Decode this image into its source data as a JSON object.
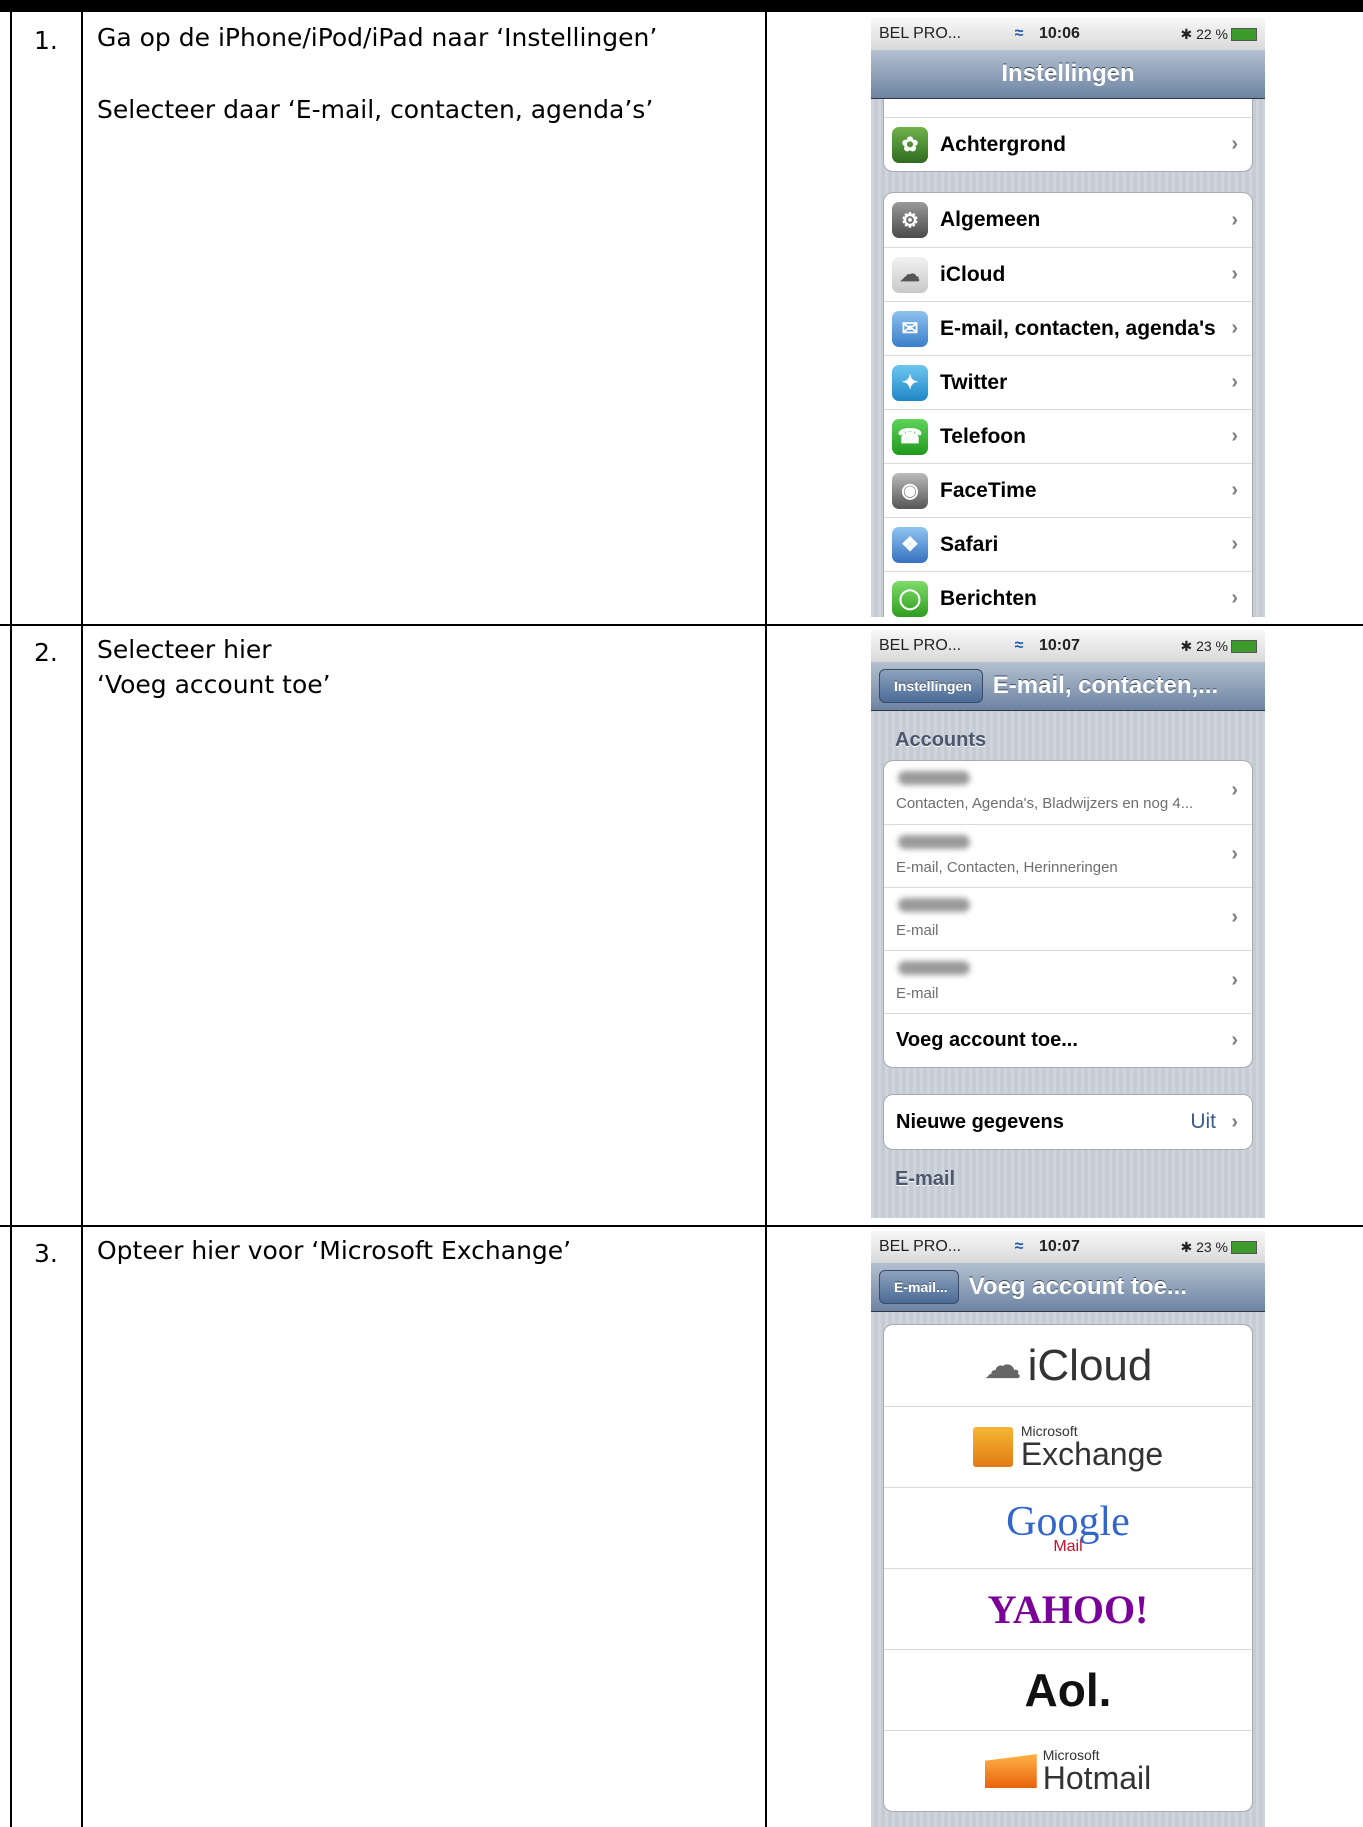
{
  "steps": [
    {
      "number": "1.",
      "lines": [
        "Ga op de iPhone/iPod/iPad naar ‘Instellingen’",
        "Selecteer daar ‘E-mail, contacten, agenda’s’"
      ]
    },
    {
      "number": "2.",
      "lines": [
        "Selecteer hier",
        "‘Voeg account toe’"
      ]
    },
    {
      "number": "3.",
      "lines": [
        "Opteer hier voor ‘Microsoft Exchange’"
      ]
    }
  ],
  "status": [
    {
      "carrier": "BEL PRO...",
      "time": "10:06",
      "battery": "22 %"
    },
    {
      "carrier": "BEL PRO...",
      "time": "10:07",
      "battery": "23 %"
    },
    {
      "carrier": "BEL PRO...",
      "time": "10:07",
      "battery": "23 %"
    }
  ],
  "screen1": {
    "title": "Instellingen",
    "top_item": "Achtergrond",
    "items": [
      "Algemeen",
      "iCloud",
      "E-mail, contacten, agenda's",
      "Twitter",
      "Telefoon",
      "FaceTime",
      "Safari",
      "Berichten"
    ]
  },
  "screen2": {
    "back": "Instellingen",
    "title": "E-mail, contacten,...",
    "section": "Accounts",
    "accounts": [
      {
        "sub": "Contacten, Agenda's, Bladwijzers en nog 4..."
      },
      {
        "sub": "E-mail, Contacten, Herinneringen"
      },
      {
        "sub": "E-mail"
      },
      {
        "sub": "E-mail"
      }
    ],
    "add": "Voeg account toe...",
    "fetch_label": "Nieuwe gegevens",
    "fetch_value": "Uit",
    "section2": "E-mail"
  },
  "screen3": {
    "back": "E-mail...",
    "title": "Voeg account toe...",
    "providers": {
      "icloud": "iCloud",
      "exchange_small": "Microsoft",
      "exchange": "Exchange",
      "google": "Google",
      "google_mail": "Mail",
      "yahoo": "YAHOO!",
      "aol": "Aol.",
      "hotmail_small": "Microsoft",
      "hotmail": "Hotmail"
    }
  }
}
